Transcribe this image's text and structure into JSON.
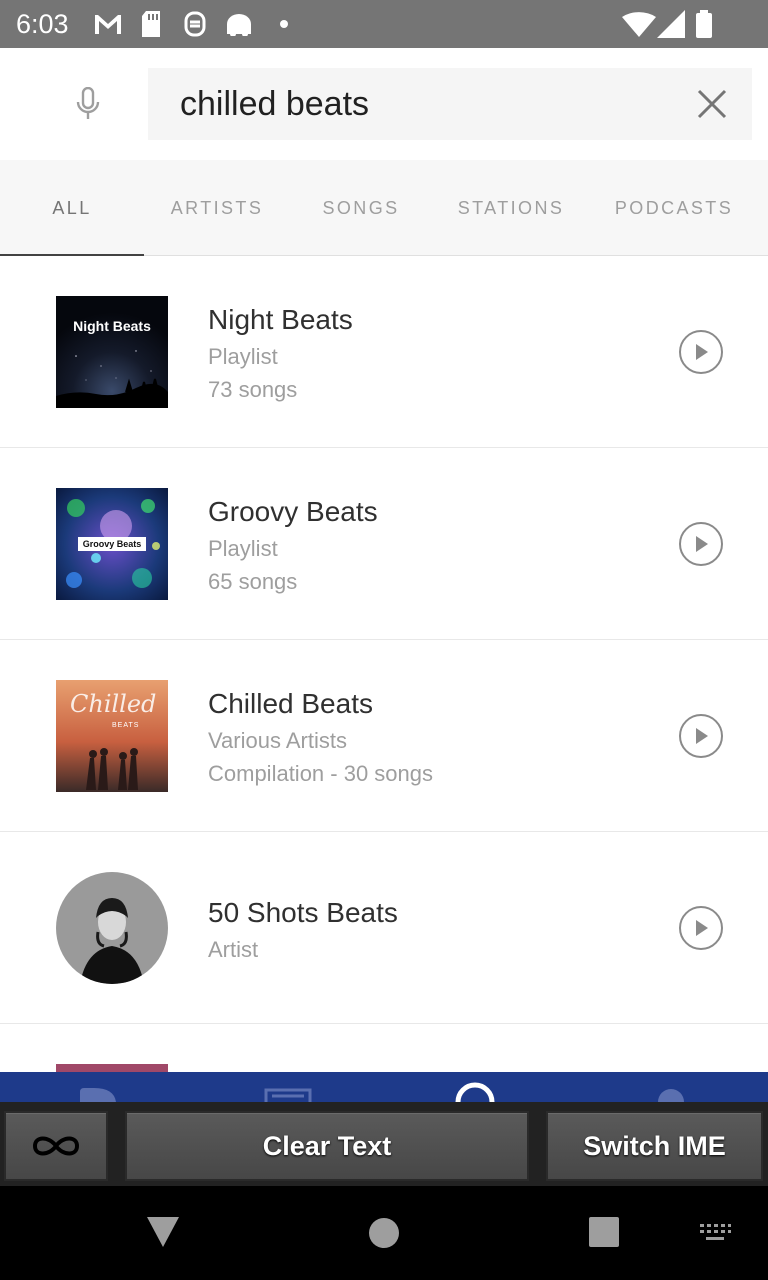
{
  "status_bar": {
    "time": "6:03",
    "notification_icons": [
      "gmail-icon",
      "sd-card-icon",
      "app-icon",
      "android-icon",
      "dot-icon"
    ],
    "system_icons": [
      "wifi-icon",
      "cell-signal-icon",
      "battery-icon"
    ]
  },
  "search": {
    "query": "chilled beats",
    "mic_icon": "microphone-icon",
    "clear_icon": "close-icon"
  },
  "tabs": [
    {
      "label": "ALL",
      "active": true
    },
    {
      "label": "ARTISTS",
      "active": false
    },
    {
      "label": "SONGS",
      "active": false
    },
    {
      "label": "STATIONS",
      "active": false
    },
    {
      "label": "PODCASTS",
      "active": false
    }
  ],
  "results": [
    {
      "title": "Night Beats",
      "line1": "Playlist",
      "line2": "73 songs",
      "art_text": "Night Beats"
    },
    {
      "title": "Groovy Beats",
      "line1": "Playlist",
      "line2": "65 songs",
      "art_text": "Groovy Beats"
    },
    {
      "title": "Chilled Beats",
      "line1": "Various Artists",
      "line2": "Compilation - 30 songs",
      "art_text": "Chilled",
      "art_subtext": "BEATS"
    },
    {
      "title": "50 Shots Beats",
      "line1": "Artist"
    }
  ],
  "ime_toolbar": {
    "clear_label": "Clear Text",
    "switch_label": "Switch IME",
    "loop_icon": "infinity-icon"
  },
  "nav_bar": {
    "icons": [
      "back-icon",
      "home-icon",
      "recents-icon",
      "keyboard-icon"
    ]
  },
  "colors": {
    "status_bar": "#757575",
    "bottom_nav": "#1e3a8a",
    "tab_active": "#757575",
    "tab_inactive": "#9e9e9e"
  }
}
